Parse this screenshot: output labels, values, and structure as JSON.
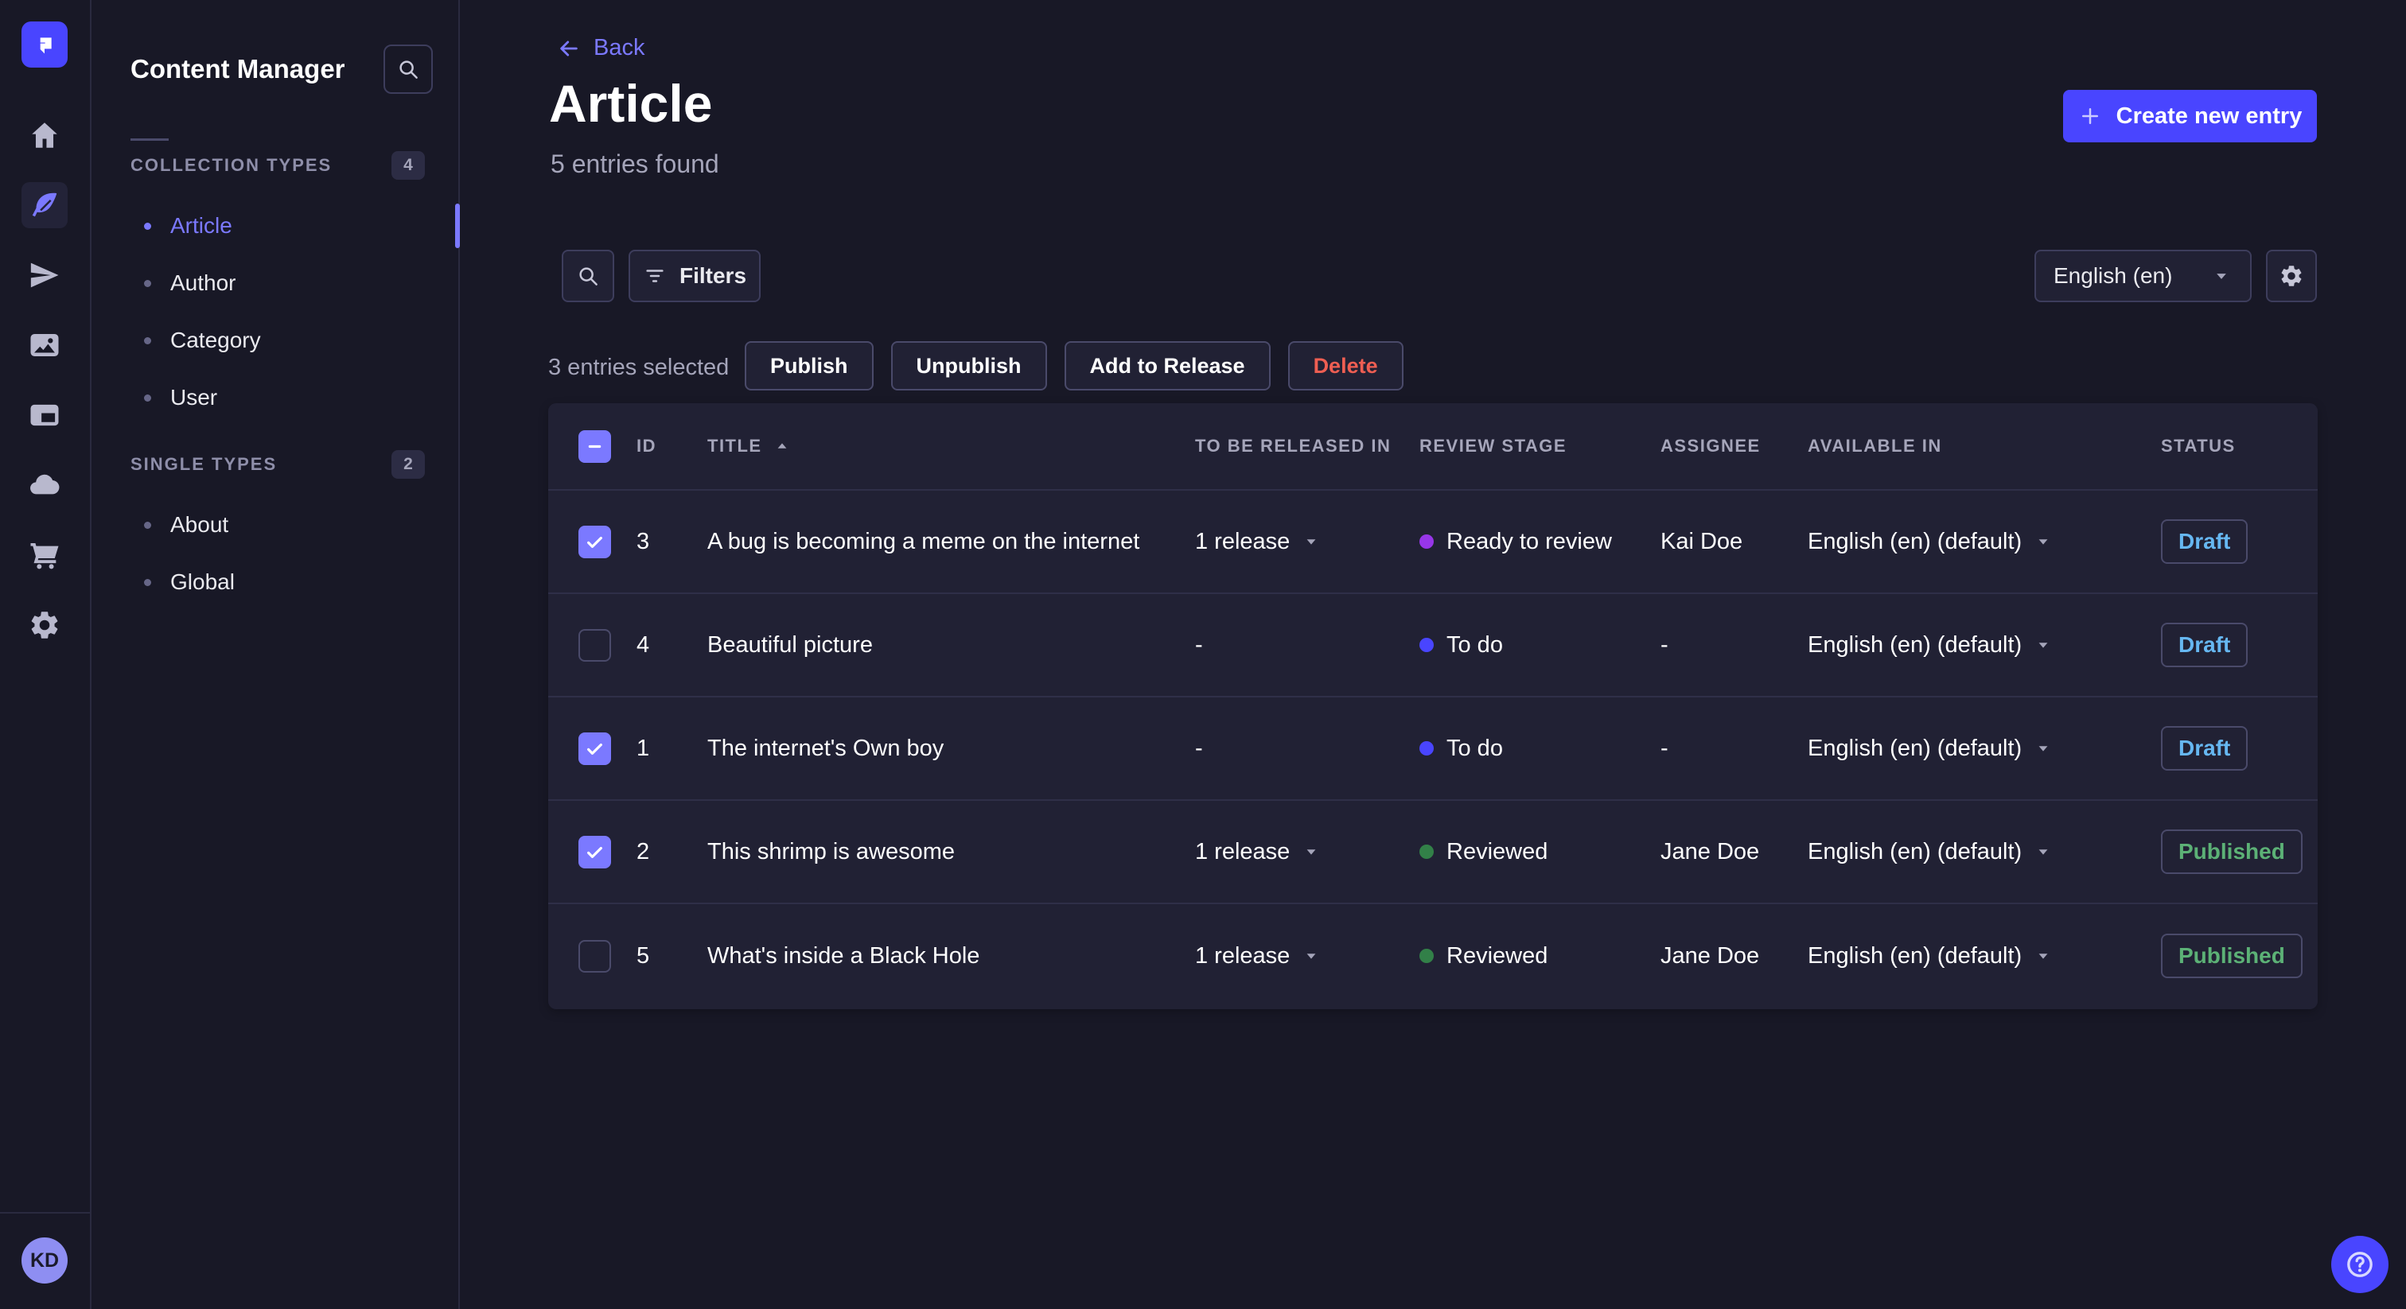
{
  "rail": {
    "items": [
      {
        "name": "home",
        "icon": "home",
        "active": false
      },
      {
        "name": "content-manager",
        "icon": "feather",
        "active": true
      },
      {
        "name": "releases",
        "icon": "paper-plane",
        "active": false
      },
      {
        "name": "media-library",
        "icon": "images",
        "active": false
      },
      {
        "name": "content-type-builder",
        "icon": "layout",
        "active": false
      },
      {
        "name": "deploy",
        "icon": "cloud",
        "active": false
      },
      {
        "name": "marketplace",
        "icon": "cart",
        "active": false
      },
      {
        "name": "settings",
        "icon": "gear",
        "active": false
      }
    ],
    "avatar": "KD"
  },
  "sidebar": {
    "title": "Content Manager",
    "sections": [
      {
        "label": "COLLECTION TYPES",
        "badge": "4",
        "items": [
          {
            "label": "Article",
            "active": true
          },
          {
            "label": "Author",
            "active": false
          },
          {
            "label": "Category",
            "active": false
          },
          {
            "label": "User",
            "active": false
          }
        ]
      },
      {
        "label": "SINGLE TYPES",
        "badge": "2",
        "items": [
          {
            "label": "About",
            "active": false
          },
          {
            "label": "Global",
            "active": false
          }
        ]
      }
    ]
  },
  "header": {
    "back_label": "Back",
    "title": "Article",
    "subtitle": "5 entries found",
    "create_label": "Create new entry"
  },
  "toolbar": {
    "filters_label": "Filters",
    "locale": "English (en)"
  },
  "selection": {
    "count_text": "3 entries selected",
    "actions": [
      {
        "label": "Publish",
        "danger": false
      },
      {
        "label": "Unpublish",
        "danger": false
      },
      {
        "label": "Add to Release",
        "danger": false
      },
      {
        "label": "Delete",
        "danger": true
      }
    ]
  },
  "table": {
    "columns": {
      "id": "ID",
      "title": "TITLE",
      "released": "TO BE RELEASED IN",
      "stage": "REVIEW STAGE",
      "assignee": "ASSIGNEE",
      "available": "AVAILABLE IN",
      "status": "STATUS"
    },
    "rows": [
      {
        "checked": true,
        "id": "3",
        "title": "A bug is becoming a meme on the internet",
        "release": {
          "label": "1 release",
          "dropdown": true
        },
        "stage": "Ready to review",
        "assignee": "Kai Doe",
        "locale": "English (en) (default)",
        "status": "Draft"
      },
      {
        "checked": false,
        "id": "4",
        "title": "Beautiful picture",
        "release": {
          "label": "-",
          "dropdown": false
        },
        "stage": "To do",
        "assignee": "-",
        "locale": "English (en) (default)",
        "status": "Draft"
      },
      {
        "checked": true,
        "id": "1",
        "title": "The internet's Own boy",
        "release": {
          "label": "-",
          "dropdown": false
        },
        "stage": "To do",
        "assignee": "-",
        "locale": "English (en) (default)",
        "status": "Draft"
      },
      {
        "checked": true,
        "id": "2",
        "title": "This shrimp is awesome",
        "release": {
          "label": "1 release",
          "dropdown": true
        },
        "stage": "Reviewed",
        "assignee": "Jane Doe",
        "locale": "English (en) (default)",
        "status": "Published"
      },
      {
        "checked": false,
        "id": "5",
        "title": "What's inside a Black Hole",
        "release": {
          "label": "1 release",
          "dropdown": true
        },
        "stage": "Reviewed",
        "assignee": "Jane Doe",
        "locale": "English (en) (default)",
        "status": "Published"
      }
    ]
  },
  "stage_colors": {
    "To do": "#4945ff",
    "Ready to review": "#9736e8",
    "Reviewed": "#328048"
  },
  "colors": {
    "accent": "#4945ff",
    "accent_light": "#7b79ff",
    "draft": "#66b7f1",
    "published": "#5cb176",
    "danger": "#ee5e52",
    "surface": "#212134",
    "background": "#181826"
  }
}
